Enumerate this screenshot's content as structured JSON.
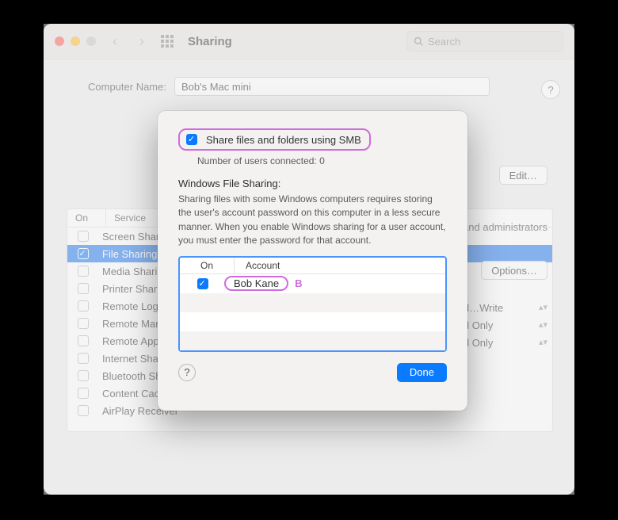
{
  "window": {
    "title": "Sharing",
    "search_placeholder": "Search"
  },
  "computer_name": {
    "label": "Computer Name:",
    "value": "Bob's Mac mini",
    "edit": "Edit…"
  },
  "services": {
    "col_on": "On",
    "col_service": "Service",
    "items": [
      {
        "on": false,
        "name": "Screen Sharing"
      },
      {
        "on": true,
        "name": "File Sharing"
      },
      {
        "on": false,
        "name": "Media Sharing"
      },
      {
        "on": false,
        "name": "Printer Sharing"
      },
      {
        "on": false,
        "name": "Remote Login"
      },
      {
        "on": false,
        "name": "Remote Management"
      },
      {
        "on": false,
        "name": "Remote Apple Events"
      },
      {
        "on": false,
        "name": "Internet Sharing"
      },
      {
        "on": false,
        "name": "Bluetooth Sharing"
      },
      {
        "on": false,
        "name": "Content Caching"
      },
      {
        "on": false,
        "name": "AirPlay Receiver"
      }
    ]
  },
  "right": {
    "admins": "and administrators",
    "options": "Options…",
    "perms": [
      "Read…Write",
      "Read Only",
      "Read Only"
    ]
  },
  "modal": {
    "smb_label": "Share files and folders using SMB",
    "connected": "Number of users connected: 0",
    "wfs_title": "Windows File Sharing:",
    "wfs_text": "Sharing files with some Windows computers requires storing the user's account password on this computer in a less secure manner. When you enable Windows sharing for a user account, you must enter the password for that account.",
    "col_on": "On",
    "col_account": "Account",
    "accounts": [
      {
        "on": true,
        "name": "Bob Kane"
      }
    ],
    "annotation_b": "B",
    "done": "Done"
  }
}
